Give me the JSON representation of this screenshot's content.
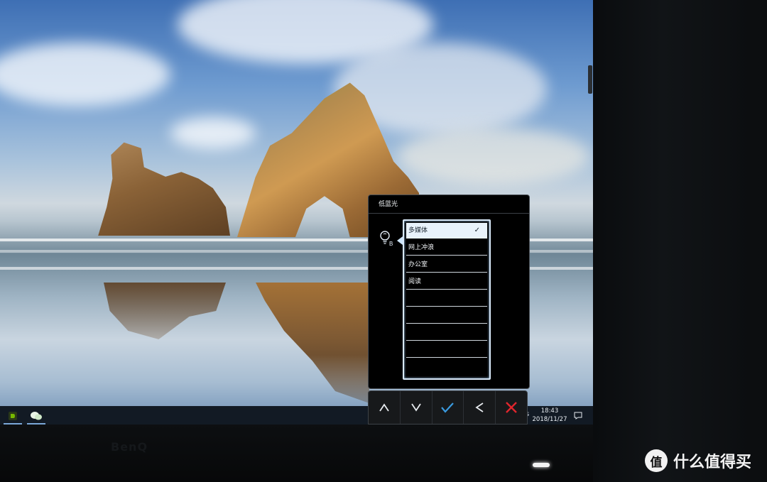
{
  "osd": {
    "title": "低蓝光",
    "icon": "low-blue-light-bulb-icon",
    "options": [
      {
        "label": "多媒体",
        "selected": true,
        "check": "✓"
      },
      {
        "label": "网上冲浪",
        "selected": false
      },
      {
        "label": "办公室",
        "selected": false
      },
      {
        "label": "阅读",
        "selected": false
      },
      {
        "label": "",
        "selected": false
      },
      {
        "label": "",
        "selected": false
      },
      {
        "label": "",
        "selected": false
      },
      {
        "label": "",
        "selected": false
      }
    ],
    "buttons": [
      {
        "name": "up",
        "glyph": "up-caret-icon"
      },
      {
        "name": "down",
        "glyph": "down-caret-icon"
      },
      {
        "name": "confirm",
        "glyph": "check-icon"
      },
      {
        "name": "back",
        "glyph": "left-caret-icon"
      },
      {
        "name": "exit",
        "glyph": "close-icon"
      }
    ],
    "colors": {
      "confirm": "#3a9be0",
      "exit": "#e0262d",
      "selected_bg": "#e8f2fb"
    }
  },
  "taskbar": {
    "apps": [
      {
        "name": "nvidia-app",
        "icon": "nvidia-icon"
      },
      {
        "name": "wechat-app",
        "icon": "wechat-icon"
      }
    ],
    "tray_fragment": "s",
    "time": "18:43",
    "date": "2018/11/27"
  },
  "bezel": {
    "logo": "BenQ"
  },
  "watermark": {
    "text": "什么值得买",
    "mark": "值"
  }
}
